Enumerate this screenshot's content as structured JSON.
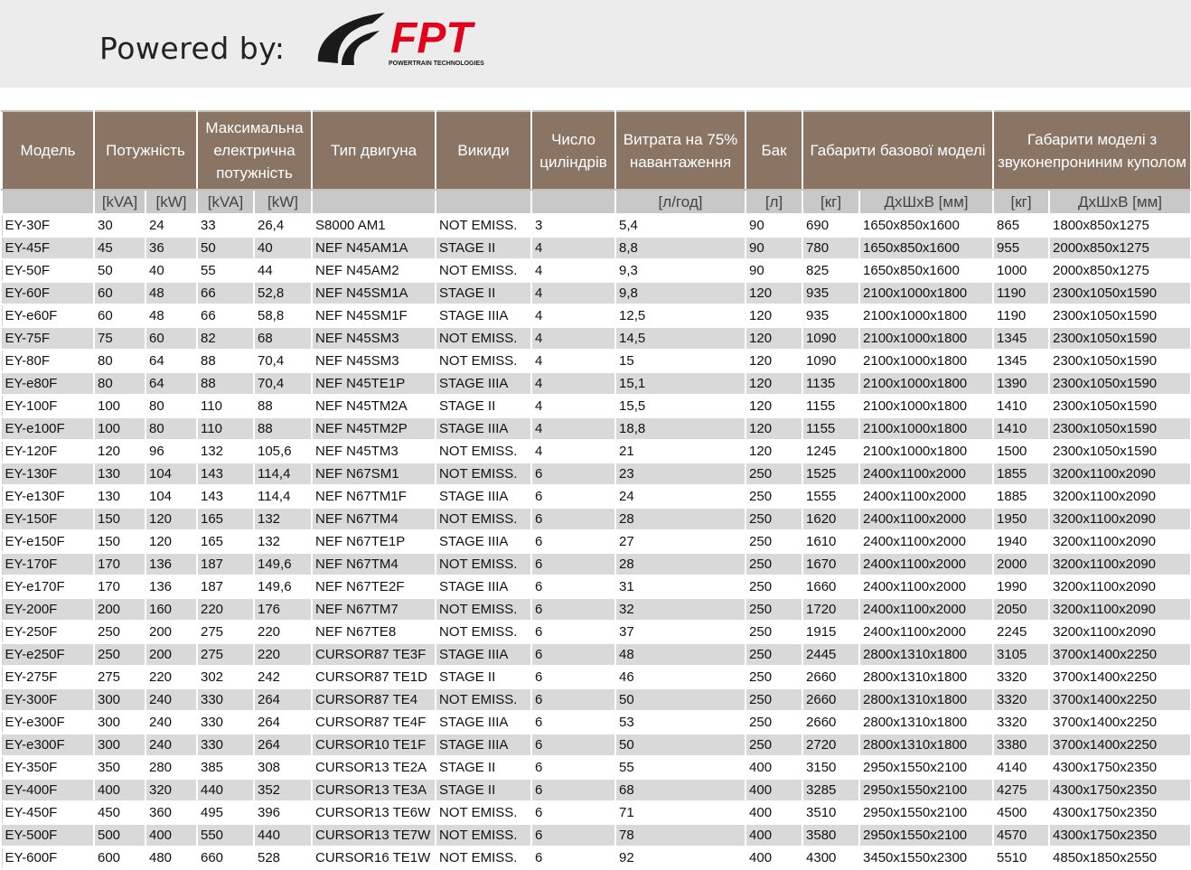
{
  "banner": {
    "powered_by": "Powered by:",
    "logo_text": "FPT",
    "logo_subtext": "POWERTRAIN TECHNOLOGIES",
    "logo_color": "#e2001a"
  },
  "table": {
    "headers": [
      "Модель",
      "Потужність",
      "Максимальна електрична потужність",
      "Тип двигуна",
      "Викиди",
      "Число циліндрів",
      "Витрата на 75% навантаження",
      "Бак",
      "Габарити базової моделі",
      "Габарити моделі з звуконепрониним куполом"
    ],
    "units": [
      "",
      "[kVA]",
      "[kW]",
      "[kVA]",
      "[kW]",
      "",
      "",
      "",
      "[л/год]",
      "[л]",
      "[кг]",
      "ДхШхВ [мм]",
      "[кг]",
      "ДхШхВ [мм]"
    ],
    "rows": [
      [
        "EY-30F",
        "30",
        "24",
        "33",
        "26,4",
        "S8000 AM1",
        "NOT EMISS.",
        "3",
        "5,4",
        "90",
        "690",
        "1650x850x1600",
        "865",
        "1800x850x1275"
      ],
      [
        "EY-45F",
        "45",
        "36",
        "50",
        "40",
        "NEF N45AM1A",
        "STAGE II",
        "4",
        "8,8",
        "90",
        "780",
        "1650x850x1600",
        "955",
        "2000x850x1275"
      ],
      [
        "EY-50F",
        "50",
        "40",
        "55",
        "44",
        "NEF N45AM2",
        "NOT EMISS.",
        "4",
        "9,3",
        "90",
        "825",
        "1650x850x1600",
        "1000",
        "2000x850x1275"
      ],
      [
        "EY-60F",
        "60",
        "48",
        "66",
        "52,8",
        "NEF N45SM1A",
        "STAGE II",
        "4",
        "9,8",
        "120",
        "935",
        "2100x1000x1800",
        "1190",
        "2300x1050x1590"
      ],
      [
        "EY-e60F",
        "60",
        "48",
        "66",
        "58,8",
        "NEF N45SM1F",
        "STAGE IIIA",
        "4",
        "12,5",
        "120",
        "935",
        "2100x1000x1800",
        "1190",
        "2300x1050x1590"
      ],
      [
        "EY-75F",
        "75",
        "60",
        "82",
        "68",
        "NEF N45SM3",
        "NOT EMISS.",
        "4",
        "14,5",
        "120",
        "1090",
        "2100x1000x1800",
        "1345",
        "2300x1050x1590"
      ],
      [
        "EY-80F",
        "80",
        "64",
        "88",
        "70,4",
        "NEF N45SM3",
        "NOT EMISS.",
        "4",
        "15",
        "120",
        "1090",
        "2100x1000x1800",
        "1345",
        "2300x1050x1590"
      ],
      [
        "EY-e80F",
        "80",
        "64",
        "88",
        "70,4",
        "NEF N45TE1P",
        "STAGE IIIA",
        "4",
        "15,1",
        "120",
        "1135",
        "2100x1000x1800",
        "1390",
        "2300x1050x1590"
      ],
      [
        "EY-100F",
        "100",
        "80",
        "110",
        "88",
        "NEF N45TM2A",
        "STAGE II",
        "4",
        "15,5",
        "120",
        "1155",
        "2100x1000x1800",
        "1410",
        "2300x1050x1590"
      ],
      [
        "EY-e100F",
        "100",
        "80",
        "110",
        "88",
        "NEF N45TM2P",
        "STAGE IIIA",
        "4",
        "18,8",
        "120",
        "1155",
        "2100x1000x1800",
        "1410",
        "2300x1050x1590"
      ],
      [
        "EY-120F",
        "120",
        "96",
        "132",
        "105,6",
        "NEF N45TM3",
        "NOT EMISS.",
        "4",
        "21",
        "120",
        "1245",
        "2100x1000x1800",
        "1500",
        "2300x1050x1590"
      ],
      [
        "EY-130F",
        "130",
        "104",
        "143",
        "114,4",
        "NEF  N67SM1",
        "NOT EMISS.",
        "6",
        "23",
        "250",
        "1525",
        "2400x1100x2000",
        "1855",
        "3200x1100x2090"
      ],
      [
        "EY-e130F",
        "130",
        "104",
        "143",
        "114,4",
        "NEF  N67TM1F",
        "STAGE IIIA",
        "6",
        "24",
        "250",
        "1555",
        "2400x1100x2000",
        "1885",
        "3200x1100x2090"
      ],
      [
        "EY-150F",
        "150",
        "120",
        "165",
        "132",
        "NEF N67TM4",
        "NOT EMISS.",
        "6",
        "28",
        "250",
        "1620",
        "2400x1100x2000",
        "1950",
        "3200x1100x2090"
      ],
      [
        "EY-e150F",
        "150",
        "120",
        "165",
        "132",
        "NEF N67TE1P",
        "STAGE IIIA",
        "6",
        "27",
        "250",
        "1610",
        "2400x1100x2000",
        "1940",
        "3200x1100x2090"
      ],
      [
        "EY-170F",
        "170",
        "136",
        "187",
        "149,6",
        "NEF N67TM4",
        "NOT EMISS.",
        "6",
        "28",
        "250",
        "1670",
        "2400x1100x2000",
        "2000",
        "3200x1100x2090"
      ],
      [
        "EY-e170F",
        "170",
        "136",
        "187",
        "149,6",
        "NEF N67TE2F",
        "STAGE IIIA",
        "6",
        "31",
        "250",
        "1660",
        "2400x1100x2000",
        "1990",
        "3200x1100x2090"
      ],
      [
        "EY-200F",
        "200",
        "160",
        "220",
        "176",
        "NEF N67TM7",
        "NOT EMISS.",
        "6",
        "32",
        "250",
        "1720",
        "2400x1100x2000",
        "2050",
        "3200x1100x2090"
      ],
      [
        "EY-250F",
        "250",
        "200",
        "275",
        "220",
        "NEF N67TE8",
        "NOT EMISS.",
        "6",
        "37",
        "250",
        "1915",
        "2400x1100x2000",
        "2245",
        "3200x1100x2090"
      ],
      [
        "EY-e250F",
        "250",
        "200",
        "275",
        "220",
        "CURSOR87 TE3F",
        "STAGE IIIA",
        "6",
        "48",
        "250",
        "2445",
        "2800x1310x1800",
        "3105",
        "3700x1400x2250"
      ],
      [
        "EY-275F",
        "275",
        "220",
        "302",
        "242",
        "CURSOR87 TE1D",
        "STAGE II",
        "6",
        "46",
        "250",
        "2660",
        "2800x1310x1800",
        "3320",
        "3700x1400x2250"
      ],
      [
        "EY-300F",
        "300",
        "240",
        "330",
        "264",
        "CURSOR87 TE4",
        "NOT EMISS.",
        "6",
        "50",
        "250",
        "2660",
        "2800x1310x1800",
        "3320",
        "3700x1400x2250"
      ],
      [
        "EY-e300F",
        "300",
        "240",
        "330",
        "264",
        "CURSOR87 TE4F",
        "STAGE IIIA",
        "6",
        "53",
        "250",
        "2660",
        "2800x1310x1800",
        "3320",
        "3700x1400x2250"
      ],
      [
        "EY-e300F",
        "300",
        "240",
        "330",
        "264",
        "CURSOR10 TE1F",
        "STAGE IIIA",
        "6",
        "50",
        "250",
        "2720",
        "2800x1310x1800",
        "3380",
        "3700x1400x2250"
      ],
      [
        "EY-350F",
        "350",
        "280",
        "385",
        "308",
        "CURSOR13 TE2A",
        "STAGE II",
        "6",
        "55",
        "400",
        "3150",
        "2950x1550x2100",
        "4140",
        "4300x1750x2350"
      ],
      [
        "EY-400F",
        "400",
        "320",
        "440",
        "352",
        "CURSOR13 TE3A",
        "STAGE II",
        "6",
        "68",
        "400",
        "3285",
        "2950x1550x2100",
        "4275",
        "4300x1750x2350"
      ],
      [
        "EY-450F",
        "450",
        "360",
        "495",
        "396",
        "CURSOR13 TE6W",
        "NOT EMISS.",
        "6",
        "71",
        "400",
        "3510",
        "2950x1550x2100",
        "4500",
        "4300x1750x2350"
      ],
      [
        "EY-500F",
        "500",
        "400",
        "550",
        "440",
        "CURSOR13 TE7W",
        "NOT EMISS.",
        "6",
        "78",
        "400",
        "3580",
        "2950x1550x2100",
        "4570",
        "4300x1750x2350"
      ],
      [
        "EY-600F",
        "600",
        "480",
        "660",
        "528",
        "CURSOR16 TE1W",
        "NOT EMISS.",
        "6",
        "92",
        "400",
        "4300",
        "3450x1550x2300",
        "5510",
        "4850x1850x2550"
      ]
    ]
  }
}
